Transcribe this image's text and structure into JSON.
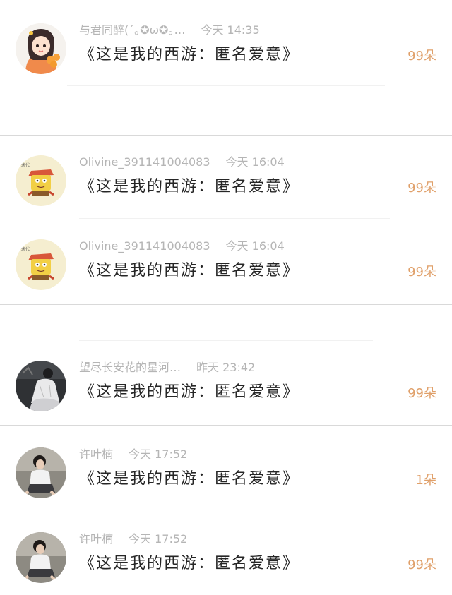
{
  "colors": {
    "count": "#e0a06a",
    "meta": "#b5b5b5",
    "text": "#262626",
    "separator": "#d9d9d9"
  },
  "entries": [
    {
      "avatar": "cartoon-girl-with-oranges-avatar",
      "name": "与君同醉(´｡✪ω✪｡…",
      "time": "今天 14:35",
      "gift": "《这是我的西游：匿名爱意》",
      "count": "99朵"
    },
    {
      "avatar": "cartoon-spongebob-avatar",
      "name": "Olivine_391141004083",
      "time": "今天 16:04",
      "gift": "《这是我的西游：匿名爱意》",
      "count": "99朵"
    },
    {
      "avatar": "cartoon-spongebob-avatar",
      "name": "Olivine_391141004083",
      "time": "今天 16:04",
      "gift": "《这是我的西游：匿名爱意》",
      "count": "99朵"
    },
    {
      "avatar": "girl-in-dress-photo-avatar",
      "name": "望尽长安花的星河…",
      "time": "昨天 23:42",
      "gift": "《这是我的西游：匿名爱意》",
      "count": "99朵"
    },
    {
      "avatar": "girl-sitting-photo-avatar",
      "name": "许叶楠",
      "time": "今天 17:52",
      "gift": "《这是我的西游：匿名爱意》",
      "count": "1朵"
    },
    {
      "avatar": "girl-sitting-photo-avatar",
      "name": "许叶楠",
      "time": "今天 17:52",
      "gift": "《这是我的西游：匿名爱意》",
      "count": "99朵"
    }
  ]
}
